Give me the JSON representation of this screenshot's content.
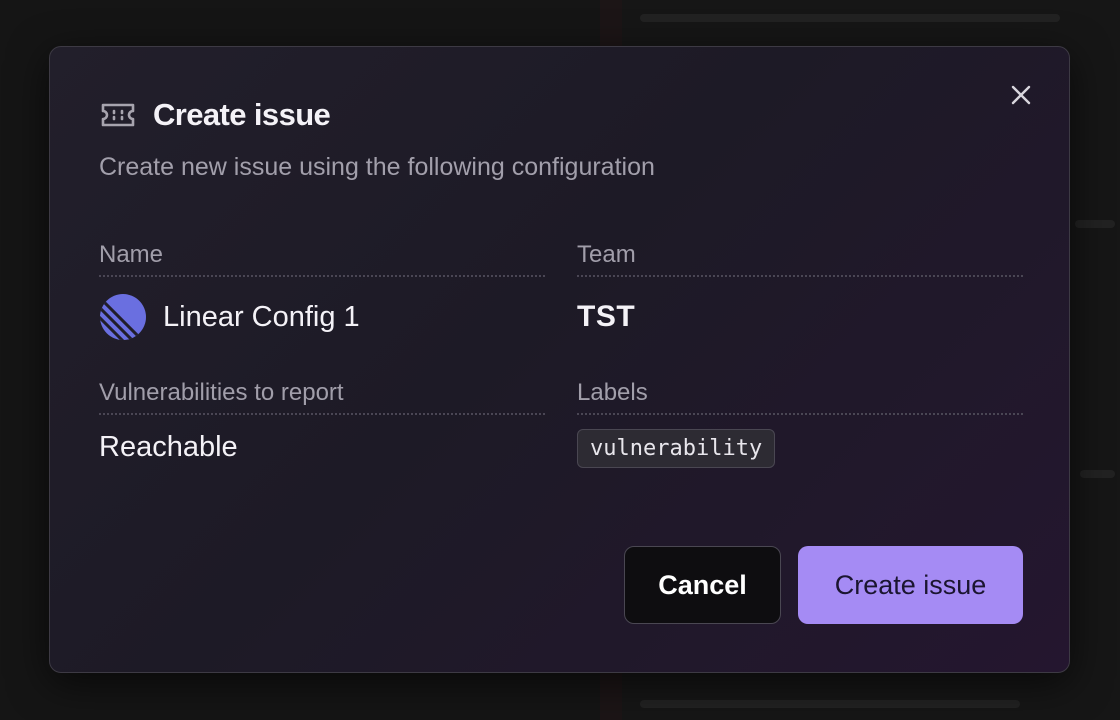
{
  "dialog": {
    "title": "Create issue",
    "subtitle": "Create new issue using the following configuration",
    "icon": "ticket-icon",
    "close_icon": "close-icon"
  },
  "fields": {
    "name": {
      "label": "Name",
      "value": "Linear Config 1",
      "icon": "linear-logo-icon"
    },
    "team": {
      "label": "Team",
      "value": "TST"
    },
    "vulnerabilities": {
      "label": "Vulnerabilities to report",
      "value": "Reachable"
    },
    "labels": {
      "label": "Labels",
      "tags": [
        "vulnerability"
      ]
    }
  },
  "buttons": {
    "cancel": "Cancel",
    "create": "Create issue"
  },
  "colors": {
    "accent": "#a58bf4",
    "linear_brand": "#5e6ad2"
  }
}
